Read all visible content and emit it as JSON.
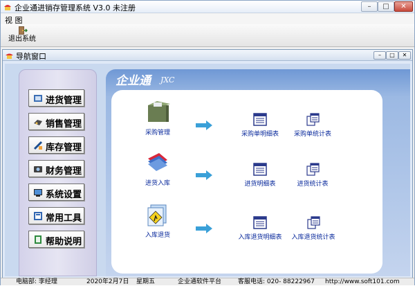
{
  "window": {
    "title": "企业通进销存管理系统 V3.0   未注册",
    "min_label": "–",
    "max_label": "□",
    "close_label": "✕"
  },
  "menu": {
    "items": [
      "视 图"
    ]
  },
  "toolbar": {
    "exit_label": "退出系统",
    "exit_icon": "exit-icon"
  },
  "child_window": {
    "title": "导航窗口",
    "min_label": "–",
    "max_label": "□",
    "close_label": "✕"
  },
  "nav": {
    "items": [
      {
        "label": "进货管理",
        "icon": "purchase-icon"
      },
      {
        "label": "销售管理",
        "icon": "sales-icon"
      },
      {
        "label": "库存管理",
        "icon": "inventory-icon"
      },
      {
        "label": "财务管理",
        "icon": "finance-icon"
      },
      {
        "label": "系统设置",
        "icon": "settings-icon"
      },
      {
        "label": "常用工具",
        "icon": "tools-icon"
      },
      {
        "label": "帮助说明",
        "icon": "help-icon"
      }
    ]
  },
  "main": {
    "brand": "企业通",
    "brand_sub": "JXC",
    "rows": [
      {
        "action": "采购管理",
        "detail": "采购单明细表",
        "stats": "采购单统计表"
      },
      {
        "action": "进货入库",
        "detail": "进货明细表",
        "stats": "进货统计表"
      },
      {
        "action": "入库退货",
        "detail": "入库退货明细表",
        "stats": "入库退货统计表"
      }
    ]
  },
  "status": {
    "computer": "电脑部: 李经理",
    "date": "2020年2月7日",
    "weekday": "星期五",
    "platform": "企业通软件平台",
    "phone": "客服电话: 020- 88222967",
    "url": "http://www.soft101.com"
  },
  "colors": {
    "accent": "#6f98d5",
    "link": "#0a2a9c",
    "arrow": "#3aa0d8"
  }
}
